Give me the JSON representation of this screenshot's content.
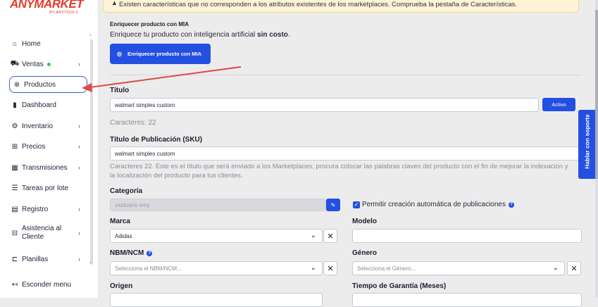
{
  "sidebar": {
    "logo": "ANYMARKET",
    "logo_sub": "BY ANYTOOLS",
    "items": [
      {
        "label": "Home",
        "icon": "home-icon",
        "glyph": "⌂",
        "chev": ""
      },
      {
        "label": "Ventas",
        "icon": "cart-icon",
        "glyph": "⛟",
        "chev": "›",
        "dot": true
      },
      {
        "label": "Productos",
        "icon": "gift-icon",
        "glyph": "⊕",
        "chev": ""
      },
      {
        "label": "Dashboard",
        "icon": "bar-chart-icon",
        "glyph": "▮",
        "chev": ""
      },
      {
        "label": "Inventario",
        "icon": "box-icon",
        "glyph": "⚙",
        "chev": "›"
      },
      {
        "label": "Precios",
        "icon": "tag-icon",
        "glyph": "⊞",
        "chev": "›"
      },
      {
        "label": "Transmisiones",
        "icon": "calendar-icon",
        "glyph": "▦",
        "chev": "›"
      },
      {
        "label": "Tareas por lote",
        "icon": "list-icon",
        "glyph": "☰",
        "chev": ""
      },
      {
        "label": "Registro",
        "icon": "registry-icon",
        "glyph": "▤",
        "chev": "›"
      },
      {
        "label": "Asistencia al Cliente",
        "icon": "support-icon",
        "glyph": "⊟",
        "chev": "›"
      },
      {
        "label": "Planillas",
        "icon": "sheet-icon",
        "glyph": "⊏",
        "chev": "›"
      }
    ],
    "hide_menu": "Esconder menu",
    "hide_glyph": "↤"
  },
  "alert": {
    "text": "Existen características que no corresponden a los atributos existentes de los marketplaces. Comprueba la pestaña de Características.",
    "glyph": "▲"
  },
  "mia": {
    "heading": "Enriquecer producto con MIA",
    "text_prefix": "Enriquece tu producto con inteligencia artificial ",
    "text_bold": "sin costo",
    "text_suffix": ".",
    "button_label": "Enriquecer producto con MIA",
    "button_glyph": "◎"
  },
  "titulo": {
    "label": "Título",
    "value": "walmart simples custom",
    "status_button": "Activo",
    "chars": "Caracteres: 22"
  },
  "sku": {
    "label": "Título de Publicación (SKU)",
    "value": "walmart simples custom",
    "description": "Caracteres 22. Este es el título que será enviado a los Marketplaces, procura colocar las palabras claves del producto con el fin de mejorar la indexación y la localización del producto para tus clientes."
  },
  "categoria": {
    "label": "Categoría",
    "value": "vestuario emy",
    "edit_glyph": "✎",
    "auto_publish_label": "Permitir creación automática de publicaciones"
  },
  "marca": {
    "label": "Marca",
    "value": "Adidas"
  },
  "modelo": {
    "label": "Modelo",
    "value": ""
  },
  "ncm": {
    "label": "NBM/NCM",
    "placeholder": "Selecciona el NBM/NCM..."
  },
  "genero": {
    "label": "Género",
    "placeholder": "Selecciona el Género..."
  },
  "origen": {
    "label": "Origen"
  },
  "garantia": {
    "label": "Tiempo de Garantía (Meses)"
  },
  "support_button": "Hablar con soporte",
  "colors": {
    "accent": "#2350e0",
    "brand": "#e23b2b",
    "arrow": "#e04848"
  }
}
